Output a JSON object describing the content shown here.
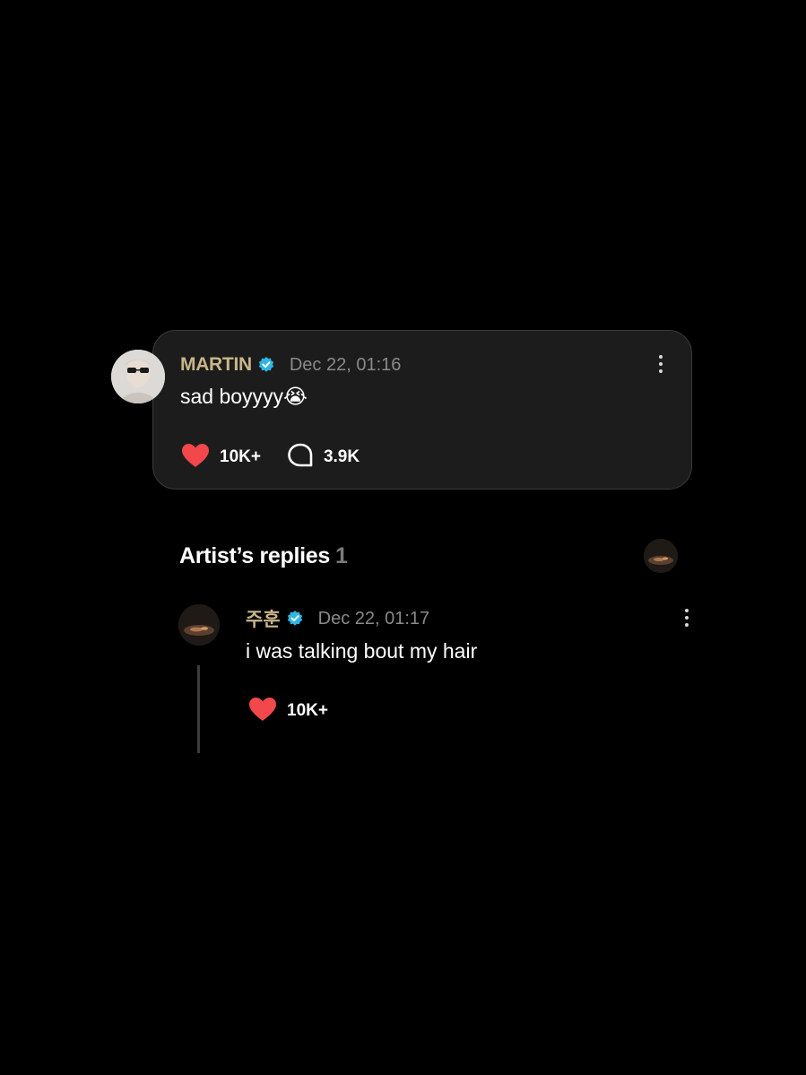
{
  "post": {
    "author": "MARTIN",
    "timestamp": "Dec 22, 01:16",
    "text": "sad boyyyy😭",
    "likes": "10K+",
    "comments": "3.9K"
  },
  "replies_section": {
    "title": "Artist’s replies",
    "count": "1"
  },
  "reply": {
    "author": "주훈",
    "timestamp": "Dec 22, 01:17",
    "text": "i was talking bout my hair",
    "likes": "10K+"
  },
  "icons": {
    "verified": "verified-badge-icon",
    "like": "heart-icon",
    "comment": "comment-bubble-icon",
    "more": "more-vertical-icon"
  },
  "colors": {
    "background": "#000000",
    "card": "#1c1c1c",
    "author_name": "#c8b58a",
    "verified": "#2fb5e3",
    "heart": "#f2474b",
    "timestamp": "#8a8a8a"
  }
}
